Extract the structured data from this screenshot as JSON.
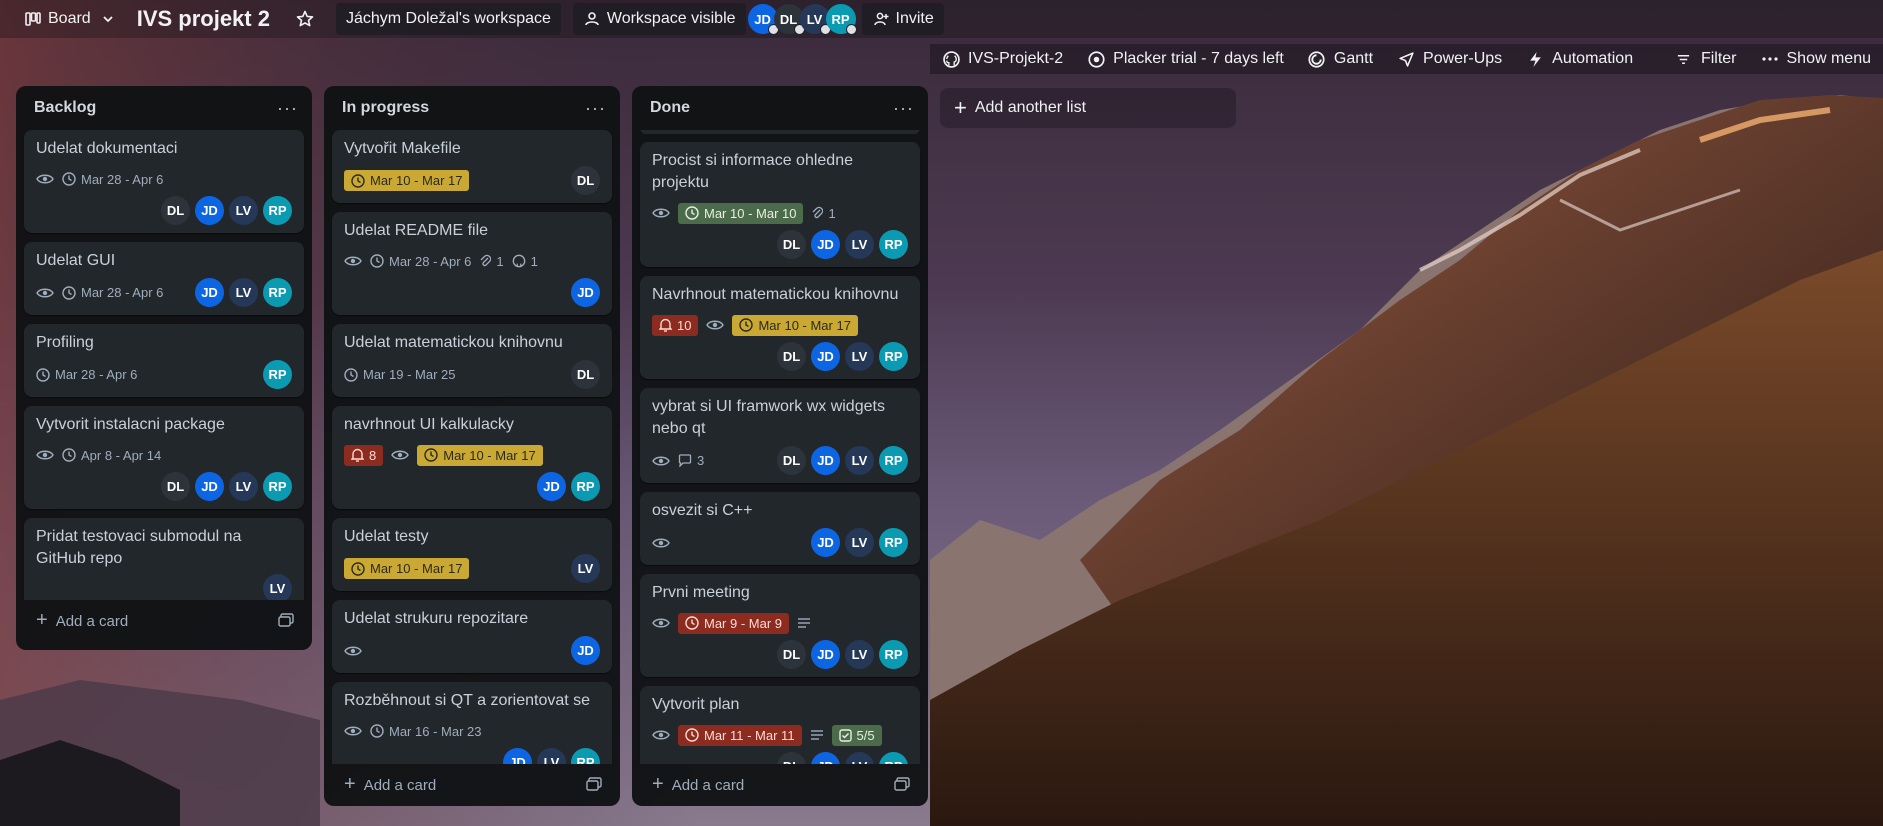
{
  "colors": {
    "avatar_dl": "#2c333a",
    "avatar_jd": "#0c66e4",
    "avatar_lv": "#253858",
    "avatar_rp": "#0a9bb3"
  },
  "topbar": {
    "view_label": "Board",
    "board_title": "IVS projekt 2",
    "workspace": "Jáchym Doležal's workspace",
    "visibility": "Workspace visible",
    "members": [
      "JD",
      "DL",
      "LV",
      "RP"
    ],
    "invite_label": "Invite"
  },
  "subbar": {
    "github": "IVS-Projekt-2",
    "placker": "Placker trial - 7 days left",
    "gantt": "Gantt",
    "powerups": "Power-Ups",
    "automation": "Automation",
    "filter": "Filter",
    "show_menu": "Show menu"
  },
  "add_list_label": "Add another list",
  "add_card_label": "Add a card",
  "lists": {
    "backlog": {
      "title": "Backlog",
      "cards": [
        {
          "title": "Udelat dokumentaci",
          "date": "Mar 28 - Apr 6",
          "members": [
            "DL",
            "JD",
            "LV",
            "RP"
          ]
        },
        {
          "title": "Udelat GUI",
          "date": "Mar 28 - Apr 6",
          "members": [
            "JD",
            "LV",
            "RP"
          ]
        },
        {
          "title": "Profiling",
          "date": "Mar 28 - Apr 6",
          "members": [
            "RP"
          ]
        },
        {
          "title": "Vytvorit instalacni package",
          "date": "Apr 8 - Apr 14",
          "members": [
            "DL",
            "JD",
            "LV",
            "RP"
          ]
        },
        {
          "title": "Pridat testovaci submodul na GitHub repo",
          "members": [
            "LV"
          ]
        }
      ]
    },
    "inprogress": {
      "title": "In progress",
      "cards": [
        {
          "title": "Vytvořit Makefile",
          "date": "Mar 10 - Mar 17",
          "members": [
            "DL"
          ]
        },
        {
          "title": "Udelat README file",
          "date": "Mar 28 - Apr 6",
          "attachments": "1",
          "github": "1",
          "members": [
            "JD"
          ]
        },
        {
          "title": "Udelat matematickou knihovnu",
          "date": "Mar 19 - Mar 25",
          "members": [
            "DL"
          ]
        },
        {
          "title": "navrhnout UI kalkulacky",
          "notifications": "8",
          "date": "Mar 10 - Mar 17",
          "members": [
            "JD",
            "RP"
          ]
        },
        {
          "title": "Udelat testy",
          "date": "Mar 10 - Mar 17",
          "members": [
            "LV"
          ]
        },
        {
          "title": "Udelat strukuru repozitare",
          "members": [
            "JD"
          ]
        },
        {
          "title": "Rozběhnout si QT a zorientovat se",
          "date": "Mar 16 - Mar 23",
          "members": [
            "JD",
            "LV",
            "RP"
          ]
        }
      ]
    },
    "done": {
      "title": "Done",
      "cards": [
        {
          "title": "Procist si informace ohledne projektu",
          "date": "Mar 10 - Mar 10",
          "attachments": "1",
          "members": [
            "DL",
            "JD",
            "LV",
            "RP"
          ]
        },
        {
          "title": "Navrhnout matematickou knihovnu",
          "notifications": "10",
          "date": "Mar 10 - Mar 17",
          "members": [
            "DL",
            "JD",
            "LV",
            "RP"
          ]
        },
        {
          "title": "vybrat si UI framwork wx widgets nebo qt",
          "comments": "3",
          "members": [
            "DL",
            "JD",
            "LV",
            "RP"
          ]
        },
        {
          "title": "osvezit si C++",
          "members": [
            "JD",
            "LV",
            "RP"
          ]
        },
        {
          "title": "Prvni meeting",
          "date": "Mar 9 - Mar 9",
          "members": [
            "DL",
            "JD",
            "LV",
            "RP"
          ]
        },
        {
          "title": "Vytvorit plan",
          "date": "Mar 11 - Mar 11",
          "checklist": "5/5",
          "members": [
            "DL",
            "JD",
            "LV",
            "RP"
          ]
        }
      ]
    }
  }
}
